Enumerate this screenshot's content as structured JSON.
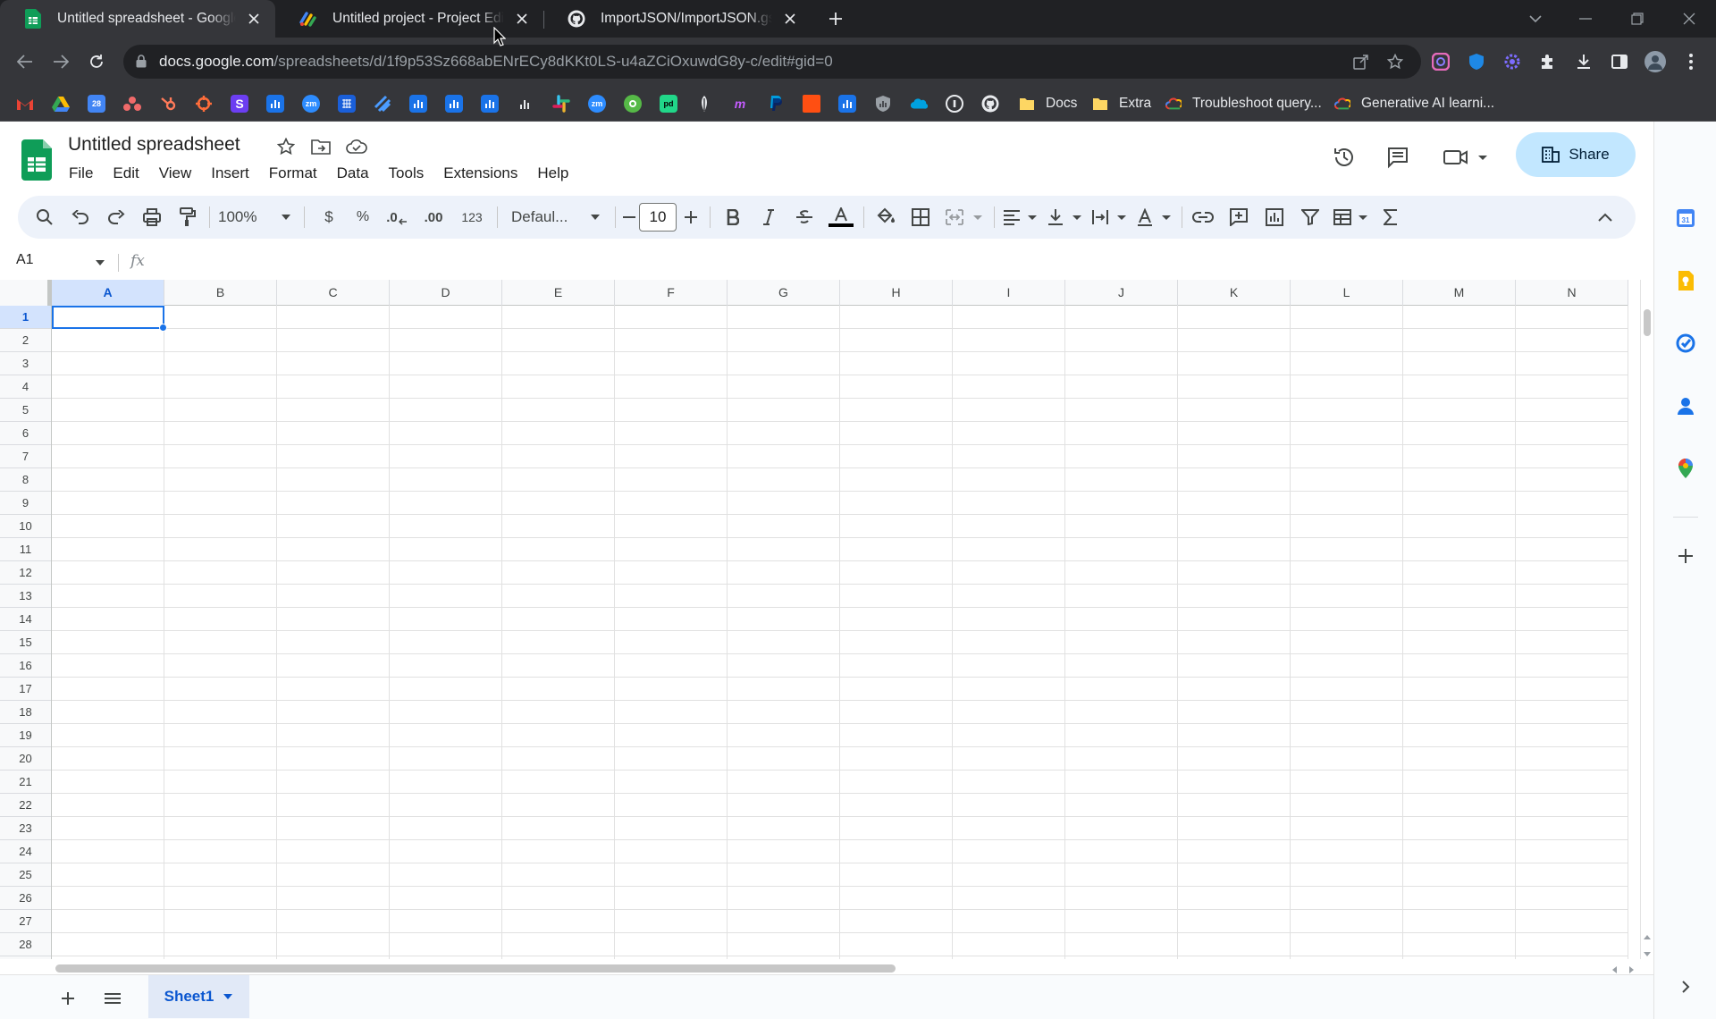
{
  "browser": {
    "tabs": [
      {
        "title": "Untitled spreadsheet - Google Sheets",
        "active": true,
        "favicon": "google-sheets-icon"
      },
      {
        "title": "Untitled project - Project Editor",
        "active": false,
        "favicon": "apps-script-icon"
      },
      {
        "title": "ImportJSON/ImportJSON.gs at master",
        "active": false,
        "favicon": "github-icon"
      }
    ],
    "url_host": "docs.google.com",
    "url_path": "/spreadsheets/d/1f9p53Sz668abENrECy8dKKt0LS-u4aZCiOxuwdG8y-c/edit#gid=0",
    "bookmarks": [
      {
        "label": "Docs",
        "icon": "folder-icon"
      },
      {
        "label": "Extra",
        "icon": "folder-icon"
      },
      {
        "label": "Troubleshoot query...",
        "icon": "google-cloud-icon"
      },
      {
        "label": "Generative AI learni...",
        "icon": "google-cloud-icon"
      }
    ]
  },
  "sheets": {
    "doc_title": "Untitled spreadsheet",
    "menus": [
      "File",
      "Edit",
      "View",
      "Insert",
      "Format",
      "Data",
      "Tools",
      "Extensions",
      "Help"
    ],
    "share_label": "Share",
    "toolbar": {
      "zoom": "100%",
      "currency": "$",
      "percent": "%",
      "dec_decrease": ".0",
      "dec_increase": ".00",
      "more_formats": "123",
      "font": "Defaul...",
      "font_size": "10"
    },
    "name_box": "A1",
    "fx": "fx",
    "columns": [
      "A",
      "B",
      "C",
      "D",
      "E",
      "F",
      "G",
      "H",
      "I",
      "J",
      "K",
      "L",
      "M",
      "N"
    ],
    "rows": [
      "1",
      "2",
      "3",
      "4",
      "5",
      "6",
      "7",
      "8",
      "9",
      "10",
      "11",
      "12",
      "13",
      "14",
      "15",
      "16",
      "17",
      "18",
      "19",
      "20",
      "21",
      "22",
      "23",
      "24",
      "25",
      "26",
      "27",
      "28"
    ],
    "active_cell": "A1",
    "sheet_tab": "Sheet1"
  },
  "colors": {
    "accent": "#1a73e8",
    "share_bg": "#c2e7ff",
    "toolbar_bg": "#edf2fa",
    "sheets_green": "#0f9d58"
  }
}
